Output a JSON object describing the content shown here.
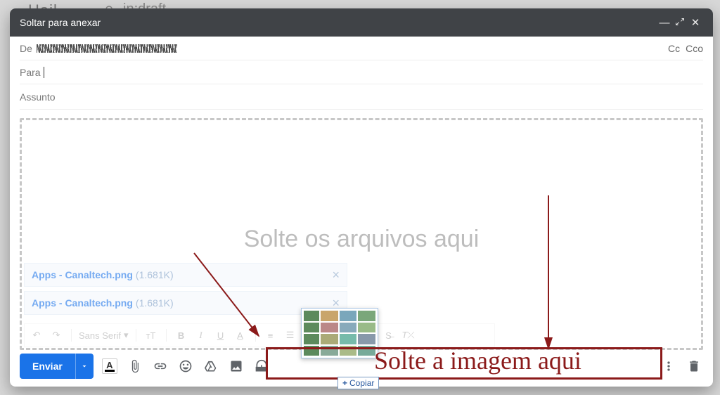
{
  "title_bar": {
    "title": "Soltar para anexar"
  },
  "from": {
    "label": "De",
    "cc": "Cc",
    "bcc": "Cco"
  },
  "to": {
    "label": "Para"
  },
  "subject": {
    "placeholder": "Assunto"
  },
  "dropzone": {
    "text": "Solte os arquivos aqui"
  },
  "attachments": [
    {
      "name": "Apps - Canaltech.png",
      "size": "(1.681K)"
    },
    {
      "name": "Apps - Canaltech.png",
      "size": "(1.681K)"
    }
  ],
  "format_toolbar": {
    "font_family": "Sans Serif"
  },
  "send": {
    "label": "Enviar"
  },
  "drag": {
    "copy_label": "Copiar"
  },
  "annotation": {
    "text": "Solte a imagem aqui"
  },
  "background": {
    "word1": "Hail",
    "word2": "in:draft"
  }
}
